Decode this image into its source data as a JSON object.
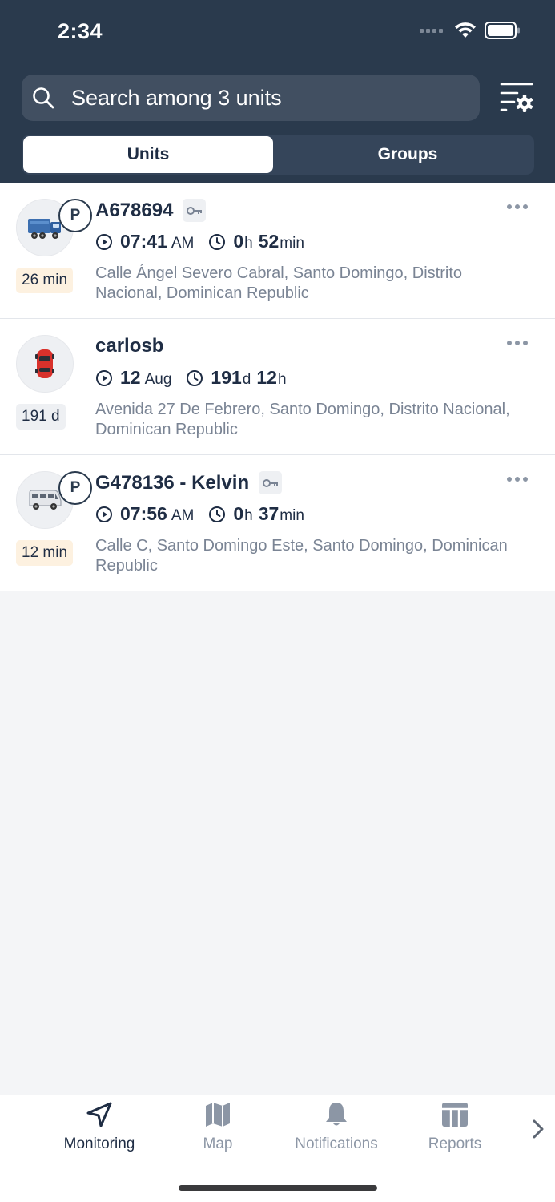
{
  "status_bar": {
    "time": "2:34"
  },
  "search": {
    "placeholder": "Search among 3 units"
  },
  "tabs": {
    "units": "Units",
    "groups": "Groups"
  },
  "units": [
    {
      "name": "A678694",
      "parked_badge": "P",
      "has_key": true,
      "vehicle_icon": "truck-icon",
      "age": "26 min",
      "time_main": "07:41",
      "time_suffix": "AM",
      "dur_a": "0",
      "dur_a_unit": "h",
      "dur_b": "52",
      "dur_b_unit": "min",
      "address": "Calle Ángel Severo Cabral, Santo Domingo, Distrito Nacional, Dominican Republic"
    },
    {
      "name": "carlosb",
      "parked_badge": "",
      "has_key": false,
      "vehicle_icon": "car-icon",
      "age": "191 d",
      "time_main": "12",
      "time_suffix": "Aug",
      "dur_a": "191",
      "dur_a_unit": "d",
      "dur_b": "12",
      "dur_b_unit": "h",
      "address": "Avenida 27 De Febrero, Santo Domingo, Distrito Nacional, Dominican Republic"
    },
    {
      "name": "G478136 - Kelvin",
      "parked_badge": "P",
      "has_key": true,
      "vehicle_icon": "van-icon",
      "age": "12 min",
      "time_main": "07:56",
      "time_suffix": "AM",
      "dur_a": "0",
      "dur_a_unit": "h",
      "dur_b": "37",
      "dur_b_unit": "min",
      "address": "Calle C, Santo Domingo Este, Santo Domingo, Dominican Republic"
    }
  ],
  "tabbar": {
    "monitoring": "Monitoring",
    "map": "Map",
    "notifications": "Notifications",
    "reports": "Reports"
  },
  "colors": {
    "header_bg": "#2a3a4d",
    "text_primary": "#1f2d44",
    "text_secondary": "#7a8494",
    "warn_badge": "#fdf1e0",
    "neutral_badge": "#eef0f3"
  }
}
